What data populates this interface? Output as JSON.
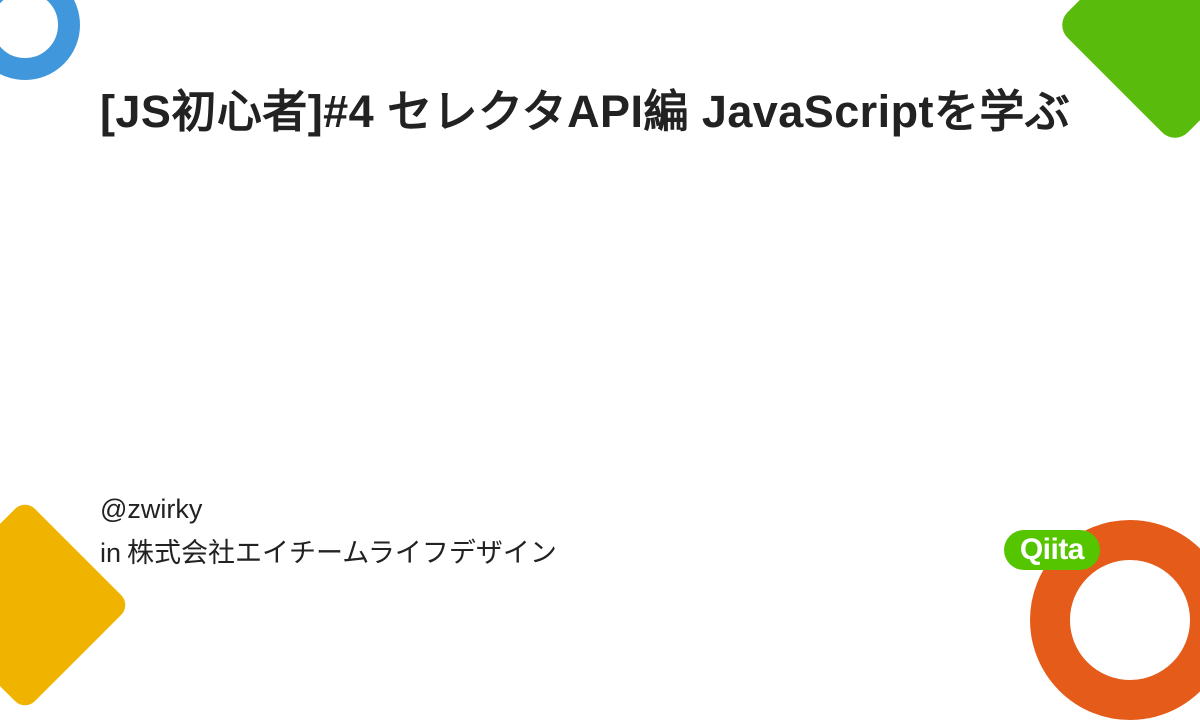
{
  "title": "[JS初心者]#4 セレクタAPI編 JavaScriptを学ぶ",
  "author_handle": "@zwirky",
  "org_prefix": "in",
  "org_name": "株式会社エイチームライフデザイン",
  "logo_text": "Qiita",
  "colors": {
    "brand_green": "#55c500",
    "accent_blue": "#4097db",
    "accent_yellow": "#f0b400",
    "accent_orange": "#e55b1a",
    "accent_green": "#59bb0c"
  }
}
